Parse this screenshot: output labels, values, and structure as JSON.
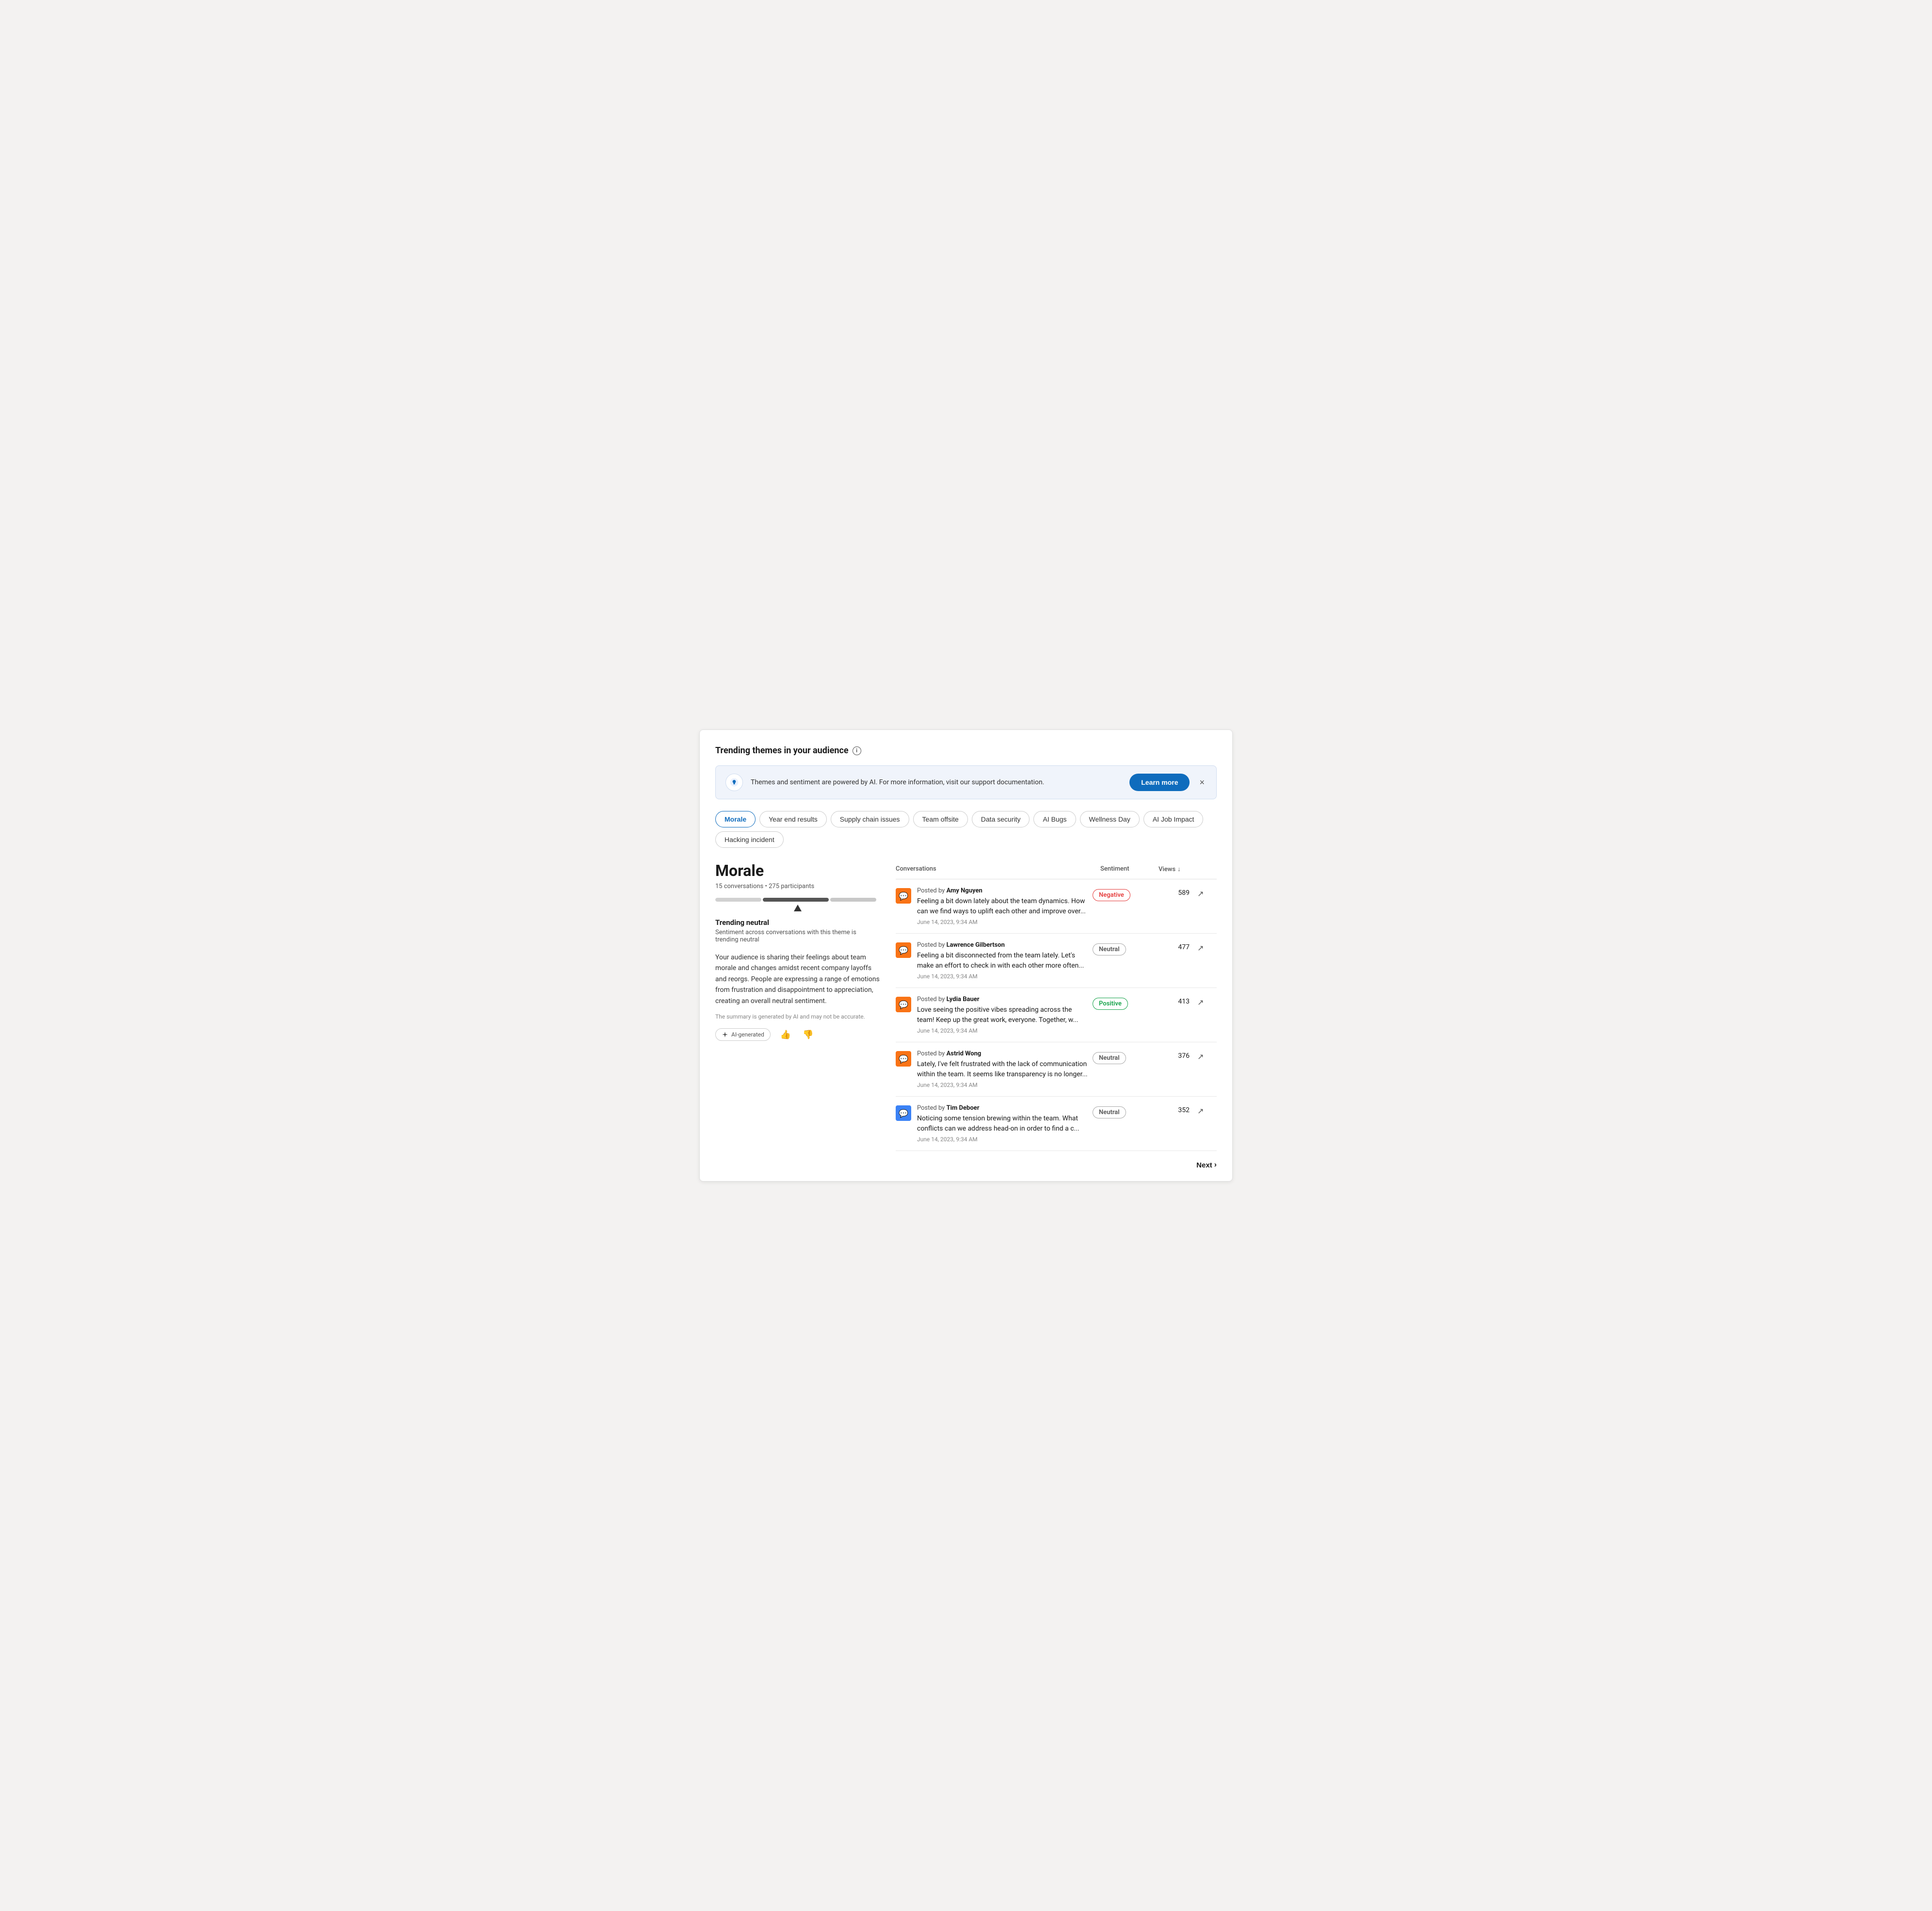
{
  "page": {
    "title": "Trending themes in your audience"
  },
  "banner": {
    "text": "Themes and sentiment are powered by AI. For more information, visit our support documentation.",
    "learn_more_label": "Learn more",
    "close_label": "×"
  },
  "themes": {
    "tabs": [
      {
        "id": "morale",
        "label": "Morale",
        "active": true
      },
      {
        "id": "year-end-results",
        "label": "Year end results",
        "active": false
      },
      {
        "id": "supply-chain-issues",
        "label": "Supply chain issues",
        "active": false
      },
      {
        "id": "team-offsite",
        "label": "Team offsite",
        "active": false
      },
      {
        "id": "data-security",
        "label": "Data security",
        "active": false
      },
      {
        "id": "ai-bugs",
        "label": "AI Bugs",
        "active": false
      },
      {
        "id": "wellness-day",
        "label": "Wellness Day",
        "active": false
      },
      {
        "id": "ai-job-impact",
        "label": "AI Job Impact",
        "active": false
      },
      {
        "id": "hacking-incident",
        "label": "Hacking incident",
        "active": false
      }
    ]
  },
  "selected_theme": {
    "name": "Morale",
    "stats": "15 conversations • 275 participants",
    "sentiment_bars": {
      "negative_width": 28,
      "neutral_width": 40,
      "positive_width": 28
    },
    "trending_label": "Trending neutral",
    "trending_sub": "Sentiment across conversations with this theme is trending neutral",
    "description": "Your audience is sharing their feelings about team morale and changes amidst recent company layoffs and reorgs. People are expressing a range of emotions from frustration and disappointment to appreciation, creating an overall neutral sentiment.",
    "ai_disclaimer": "The summary is generated by AI and may not be accurate.",
    "ai_generated_label": "AI-generated"
  },
  "conversations": {
    "col_conversations": "Conversations",
    "col_sentiment": "Sentiment",
    "col_views": "Views",
    "items": [
      {
        "author": "Amy Nguyen",
        "text": "Feeling a bit down lately about the team dynamics. How can we find ways to uplift each other and improve over...",
        "date": "June 14, 2023, 9:34 AM",
        "sentiment": "Negative",
        "sentiment_type": "negative",
        "views": "589",
        "icon_color": "orange"
      },
      {
        "author": "Lawrence Gilbertson",
        "text": "Feeling a bit disconnected from the team lately. Let's make an effort to check in with each other more often...",
        "date": "June 14, 2023, 9:34 AM",
        "sentiment": "Neutral",
        "sentiment_type": "neutral",
        "views": "477",
        "icon_color": "orange"
      },
      {
        "author": "Lydia Bauer",
        "text": "Love seeing the positive vibes spreading across the team! Keep up the great work, everyone. Together, w...",
        "date": "June 14, 2023, 9:34 AM",
        "sentiment": "Positive",
        "sentiment_type": "positive",
        "views": "413",
        "icon_color": "orange"
      },
      {
        "author": "Astrid Wong",
        "text": "Lately, I've felt frustrated with the lack of communication within the team. It seems like transparency is no longer...",
        "date": "June 14, 2023, 9:34 AM",
        "sentiment": "Neutral",
        "sentiment_type": "neutral",
        "views": "376",
        "icon_color": "orange"
      },
      {
        "author": "Tim Deboer",
        "text": "Noticing some tension brewing within the team. What conflicts can we address head-on in order to find a c...",
        "date": "June 14, 2023, 9:34 AM",
        "sentiment": "Neutral",
        "sentiment_type": "neutral",
        "views": "352",
        "icon_color": "blue"
      }
    ]
  },
  "pagination": {
    "next_label": "Next"
  }
}
